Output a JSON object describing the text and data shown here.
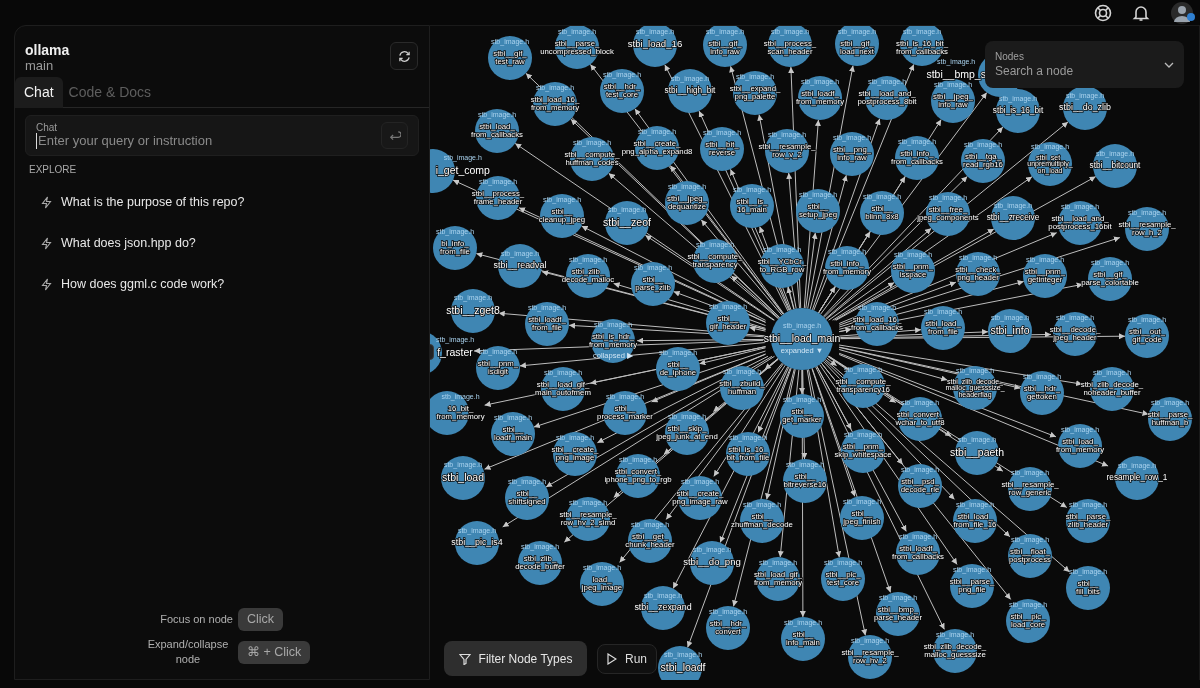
{
  "repo": {
    "name": "ollama",
    "branch": "main"
  },
  "tabs": [
    {
      "label": "Chat",
      "selected": true
    },
    {
      "label": "Code & Docs",
      "selected": false
    }
  ],
  "chat_input": {
    "label": "Chat",
    "placeholder": "Enter your query or instruction"
  },
  "explore": {
    "heading": "EXPLORE",
    "items": [
      "What is the purpose of this repo?",
      "What does json.hpp do?",
      "How does ggml.c code work?"
    ]
  },
  "shortcuts": [
    {
      "action": "Focus on node",
      "keys": "Click"
    },
    {
      "action": "Expand/collapse node",
      "keys": "⌘ + Click"
    }
  ],
  "node_search": {
    "label": "Nodes",
    "placeholder": "Search a node"
  },
  "graph": {
    "nodes": [
      {
        "label": "stbi__load_main",
        "file": "stb_image.h",
        "toggle": "expanded ▼"
      },
      {
        "label": "stbi__gif_test_raw",
        "file": "stb_image.h"
      },
      {
        "label": "stbi__parse_uncompressed_block",
        "file": "stb_image.h"
      },
      {
        "label": "stbi_load_16",
        "file": "stb_image.h"
      },
      {
        "label": "stbi__gif_info_raw",
        "file": "stb_image.h"
      },
      {
        "label": "stbi__process_scan_header",
        "file": "stb_image.h"
      },
      {
        "label": "stbi__gif_load_next",
        "file": "stb_image.h"
      },
      {
        "label": "stbi_is_16_bit_from_callbacks",
        "file": "stb_image.h"
      },
      {
        "label": "stbi__bmp_s",
        "file": "stb_image.h"
      },
      {
        "label": "stbi_load_16_from_memory",
        "file": "stb_image.h"
      },
      {
        "label": "stbi__hdr_test_core",
        "file": "stb_image.h"
      },
      {
        "label": "stbi__high_bit",
        "file": "stb_image.h"
      },
      {
        "label": "stbi__expand_png_palette",
        "file": "stb_image.h"
      },
      {
        "label": "stbi_loadf_from_memory",
        "file": "stb_image.h"
      },
      {
        "label": "stbi__load_and_postprocess_8bit",
        "file": "stb_image.h"
      },
      {
        "label": "stbi__jpeg_info_raw",
        "file": "stb_image.h"
      },
      {
        "label": "stbi_is_16_bit",
        "file": "stb_image.h"
      },
      {
        "label": "stbi__do_zlib",
        "file": "stb_image.h"
      },
      {
        "label": "stbi_load_from_callbacks",
        "file": "stb_image.h"
      },
      {
        "label": "stbi__compute_huffman_codes",
        "file": "stb_image.h"
      },
      {
        "label": "stbi__create_png_alpha_expand8",
        "file": "stb_image.h"
      },
      {
        "label": "stbi__bit_reverse",
        "file": "stb_image.h"
      },
      {
        "label": "stbi__resample_row_v_2",
        "file": "stb_image.h"
      },
      {
        "label": "stbi__png_info_raw",
        "file": "stb_image.h"
      },
      {
        "label": "stbi_info_from_callbacks",
        "file": "stb_image.h"
      },
      {
        "label": "stbi__tga_read_rgb16",
        "file": "stb_image.h"
      },
      {
        "label": "stbi_set_unpremultiply_on_load",
        "file": "stb_image.h"
      },
      {
        "label": "stbi__bitcount",
        "file": "stb_image.h"
      },
      {
        "label": "i_get_comp",
        "file": "stb_image.h"
      },
      {
        "label": "stbi__process_frame_header",
        "file": "stb_image.h"
      },
      {
        "label": "stbi__cleanup_jpeg",
        "file": "stb_image.h"
      },
      {
        "label": "stbi__zeof",
        "file": "stb_image.h"
      },
      {
        "label": "stbi__jpeg_dequantize",
        "file": "stb_image.h"
      },
      {
        "label": "stbi__is_16_main",
        "file": "stb_image.h"
      },
      {
        "label": "stbi__setup_jpeg",
        "file": "stb_image.h"
      },
      {
        "label": "stbi__blinn_8x8",
        "file": "stb_image.h"
      },
      {
        "label": "stbi__free_jpeg_components",
        "file": "stb_image.h"
      },
      {
        "label": "stbi__zreceive",
        "file": "stb_image.h"
      },
      {
        "label": "stbi__load_and_postprocess_16bit",
        "file": "stb_image.h"
      },
      {
        "label": "stbi__resample_row_h_2",
        "file": "stb_image.h"
      },
      {
        "label": "bi_info_from_file",
        "file": "stb_image.h"
      },
      {
        "label": "stbi__readval",
        "file": "stb_image.h"
      },
      {
        "label": "stbi_zlib_decode_malloc",
        "file": "stb_image.h"
      },
      {
        "label": "stbi__parse_zlib",
        "file": "stb_image.h"
      },
      {
        "label": "stbi__compute_transparency",
        "file": "stb_image.h"
      },
      {
        "label": "stbi__YCbCr_to_RGB_row",
        "file": "stb_image.h"
      },
      {
        "label": "stbi_info_from_memory",
        "file": "stb_image.h"
      },
      {
        "label": "stbi__pnm_isspace",
        "file": "stb_image.h"
      },
      {
        "label": "stbi__check_png_header",
        "file": "stb_image.h"
      },
      {
        "label": "stbi__pnm_getinteger",
        "file": "stb_image.h"
      },
      {
        "label": "stbi__gif_parse_colortable",
        "file": "stb_image.h"
      },
      {
        "label": "stbi__zget8",
        "file": "stb_image.h"
      },
      {
        "label": "stbi_loadf_from_file",
        "file": "stb_image.h"
      },
      {
        "label": "stbi_is_hdr_from_memory",
        "file": "stb_image.h",
        "toggle": "collapsed ▶"
      },
      {
        "label": "stbi__gif_header",
        "file": "stb_image.h"
      },
      {
        "label": "stbi_load_16_from_callbacks",
        "file": "stb_image.h"
      },
      {
        "label": "stbi_load_from_file",
        "file": "stb_image.h"
      },
      {
        "label": "stbi_info",
        "file": "stb_image.h"
      },
      {
        "label": "stbi__decode_jpeg_header",
        "file": "stb_image.h"
      },
      {
        "label": "stbi__out_gif_code",
        "file": "stb_image.h"
      },
      {
        "label": "f_raster",
        "file": "stb_image.h"
      },
      {
        "label": "stbi__pnm_isdigit",
        "file": "stb_image.h"
      },
      {
        "label": "stbi__load_gif_main_outofmem",
        "file": "stb_image.h"
      },
      {
        "label": "stbi__de_iphone",
        "file": "stb_image.h"
      },
      {
        "label": "stbi__zbuild_huffman",
        "file": "stb_image.h"
      },
      {
        "label": "stbi__compute_transparency16",
        "file": "stb_image.h"
      },
      {
        "label": "stbi_zlib_decode_malloc_guesssize_headerflag",
        "file": "stb_image.h"
      },
      {
        "label": "stbi__hdr_gettoken",
        "file": "stb_image.h"
      },
      {
        "label": "stbi_zlib_decode_noheader_buffer",
        "file": "stb_image.h"
      },
      {
        "label": "16_bit_from_memory",
        "file": "stb_image.h"
      },
      {
        "label": "stbi__process_marker",
        "file": "stb_image.h"
      },
      {
        "label": "stbi__get_marker",
        "file": "stb_image.h"
      },
      {
        "label": "stbi_convert_wchar_to_utf8",
        "file": "stb_image.h"
      },
      {
        "label": "stbi__parse_huffman_b",
        "file": "stb_image.h"
      },
      {
        "label": "stbi__loadf_main",
        "file": "stb_image.h"
      },
      {
        "label": "stbi__skip_jpeg_junk_at_end",
        "file": "stb_image.h"
      },
      {
        "label": "stbi__create_png_image",
        "file": "stb_image.h"
      },
      {
        "label": "stbi_is_16_bit_from_file",
        "file": "stb_image.h"
      },
      {
        "label": "stbi__pnm_skip_whitespace",
        "file": "stb_image.h"
      },
      {
        "label": "stbi__paeth",
        "file": "stb_image.h"
      },
      {
        "label": "stbi_load_from_memory",
        "file": "stb_image.h"
      },
      {
        "label": "stbi_load",
        "file": "stb_image.h"
      },
      {
        "label": "stbi_convert_iphone_png_to_rgb",
        "file": "stb_image.h"
      },
      {
        "label": "stbi__bitreverse16",
        "file": "stb_image.h"
      },
      {
        "label": "stbi__psd_decode_rle",
        "file": "stb_image.h"
      },
      {
        "label": "stbi__resample_row_generic",
        "file": "stb_image.h"
      },
      {
        "label": "resample_row_1",
        "file": "stb_image.h"
      },
      {
        "label": "stbi__shiftsigned",
        "file": "stb_image.h"
      },
      {
        "label": "stbi__create_png_image_raw",
        "file": "stb_image.h"
      },
      {
        "label": "stbi__resample_row_hv_2_simd",
        "file": "stb_image.h"
      },
      {
        "label": "stbi__zhuffman_decode",
        "file": "stb_image.h"
      },
      {
        "label": "stbi__jpeg_finish",
        "file": "stb_image.h"
      },
      {
        "label": "stbi_load_from_file_16",
        "file": "stb_image.h"
      },
      {
        "label": "stbi__parse_zlib_header",
        "file": "stb_image.h"
      },
      {
        "label": "stbi__pic_is4",
        "file": "stb_image.h"
      },
      {
        "label": "stbi_zlib_decode_buffer",
        "file": "stb_image.h"
      },
      {
        "label": "stbi__get_chunk_header",
        "file": "stb_image.h"
      },
      {
        "label": "stbi__do_png",
        "file": "stb_image.h"
      },
      {
        "label": "stbi_loadf_from_callbacks",
        "file": "stb_image.h"
      },
      {
        "label": "stbi__float_postprocess",
        "file": "stb_image.h"
      },
      {
        "label": "load_jpeg_image",
        "file": "stb_image.h"
      },
      {
        "label": "stbi_load_gif_from_memory",
        "file": "stb_image.h"
      },
      {
        "label": "stbi__pic_test_core",
        "file": "stb_image.h"
      },
      {
        "label": "stbi__parse_png_file",
        "file": "stb_image.h"
      },
      {
        "label": "stbi__fill_bits",
        "file": "stb_image.h"
      },
      {
        "label": "stbi__zexpand",
        "file": "stb_image.h"
      },
      {
        "label": "stbi__hdr_convert",
        "file": "stb_image.h"
      },
      {
        "label": "stbi__info_main",
        "file": "stb_image.h"
      },
      {
        "label": "stbi__bmp_parse_header",
        "file": "stb_image.h"
      },
      {
        "label": "stbi__pic_load_core",
        "file": "stb_image.h"
      },
      {
        "label": "stbi_zlib_decode_malloc_guesssize",
        "file": "stb_image.h"
      },
      {
        "label": "stbi_loadf",
        "file": "stb_image.h"
      },
      {
        "label": "stbi__resample_row_hv_2",
        "file": "stb_image.h"
      }
    ]
  },
  "buttons": {
    "filter": "Filter Node Types",
    "run": "Run"
  }
}
